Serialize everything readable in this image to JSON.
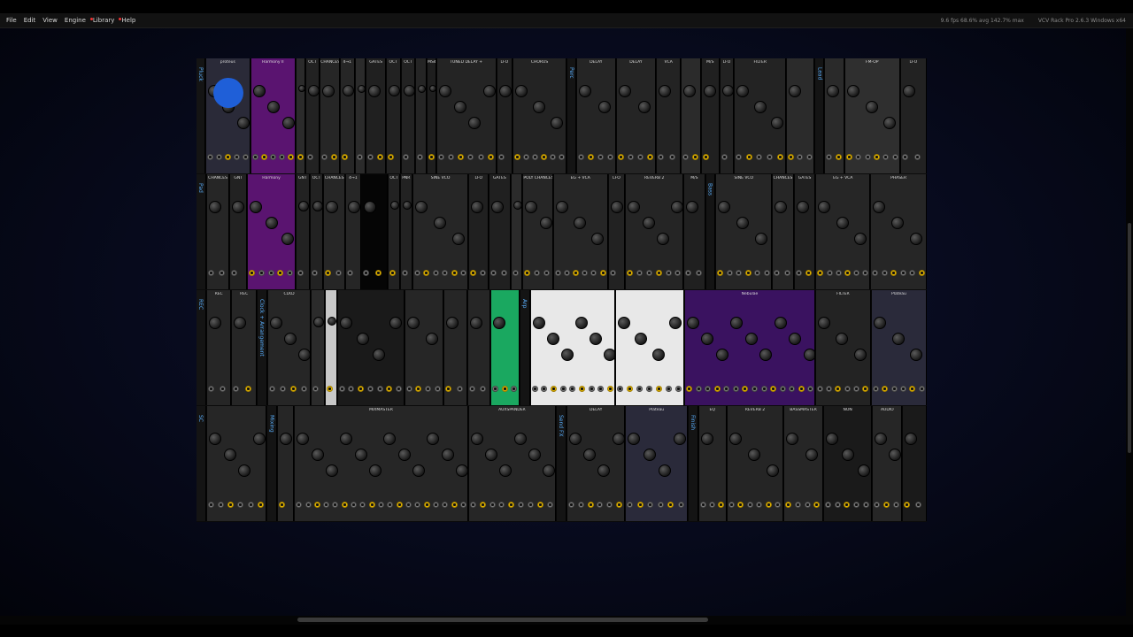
{
  "menubar": {
    "items": [
      {
        "label": "File",
        "dot": false
      },
      {
        "label": "Edit",
        "dot": false
      },
      {
        "label": "View",
        "dot": false
      },
      {
        "label": "Engine",
        "dot": false
      },
      {
        "label": "Library",
        "dot": true
      },
      {
        "label": "Help",
        "dot": true
      }
    ],
    "status": {
      "perf": "9.6 fps  68.6% avg  142.7% max",
      "app": "VCV Rack Pro 2.6.3 Windows x64"
    }
  },
  "colors": {
    "accent_blue": "#5ab0ff",
    "accent_yellow": "#f2c200",
    "accent_purple": "#7a1f8a",
    "accent_green": "#22d030"
  },
  "rows": [
    {
      "modules": [
        {
          "label": "Pluck",
          "bg": "#1c1c1c",
          "w": 10,
          "side": true
        },
        {
          "label": "proteus",
          "bg": "#2a2a38",
          "w": 52,
          "accent": "#1f5fd8"
        },
        {
          "label": "Harmony II",
          "bg": "#5a1470",
          "w": 52
        },
        {
          "label": "",
          "bg": "#2b2b2b",
          "w": 10
        },
        {
          "label": "OCT",
          "bg": "#222",
          "w": 16
        },
        {
          "label": "CHANCES",
          "bg": "#262626",
          "w": 22
        },
        {
          "label": "4→1",
          "bg": "#262626",
          "w": 16
        },
        {
          "label": "",
          "bg": "#2b2b2b",
          "w": 12
        },
        {
          "label": "GATES",
          "bg": "#202020",
          "w": 22
        },
        {
          "label": "OCT",
          "bg": "#222",
          "w": 16
        },
        {
          "label": "OCT",
          "bg": "#222",
          "w": 16
        },
        {
          "label": "",
          "bg": "#252525",
          "w": 12
        },
        {
          "label": "MS4",
          "bg": "#1e1e1e",
          "w": 10
        },
        {
          "label": "TUNED DELAY +",
          "bg": "#242424",
          "w": 70
        },
        {
          "label": "LFO",
          "bg": "#202020",
          "w": 18
        },
        {
          "label": "CHORUS",
          "bg": "#232323",
          "w": 62
        },
        {
          "label": "Perc",
          "bg": "#1c1c1c",
          "w": 10,
          "side": true
        },
        {
          "label": "DELAY",
          "bg": "#252525",
          "w": 46
        },
        {
          "label": "DELAY",
          "bg": "#252525",
          "w": 46
        },
        {
          "label": "VCA",
          "bg": "#232323",
          "w": 28
        },
        {
          "label": "",
          "bg": "#2b2b2b",
          "w": 22
        },
        {
          "label": "M/S",
          "bg": "#202020",
          "w": 20
        },
        {
          "label": "LFO",
          "bg": "#222",
          "w": 16
        },
        {
          "label": "FILTER",
          "bg": "#232323",
          "w": 60
        },
        {
          "label": "",
          "bg": "#2b2b2b",
          "w": 32
        },
        {
          "label": "Lead",
          "bg": "#1c1c1c",
          "w": 10,
          "side": true
        },
        {
          "label": "",
          "bg": "#2a2a2a",
          "w": 22
        },
        {
          "label": "FM-OP",
          "bg": "#2f2f2f",
          "w": 64
        },
        {
          "label": "LFO",
          "bg": "#222",
          "w": 30
        }
      ]
    },
    {
      "modules": [
        {
          "label": "Pad",
          "bg": "#1c1c1c",
          "w": 10,
          "side": true
        },
        {
          "label": "CHANCES",
          "bg": "#262626",
          "w": 24
        },
        {
          "label": "GNT",
          "bg": "#222",
          "w": 18
        },
        {
          "label": "Harmony",
          "bg": "#5a1470",
          "w": 52
        },
        {
          "label": "GNT",
          "bg": "#222",
          "w": 14
        },
        {
          "label": "OCT",
          "bg": "#222",
          "w": 14
        },
        {
          "label": "CHANCES",
          "bg": "#262626",
          "w": 22
        },
        {
          "label": "4→1",
          "bg": "#262626",
          "w": 16
        },
        {
          "label": "",
          "bg": "#050505",
          "w": 28
        },
        {
          "label": "OCT",
          "bg": "#222",
          "w": 12
        },
        {
          "label": "PNR",
          "bg": "#222",
          "w": 12
        },
        {
          "label": "SINE VCO",
          "bg": "#262626",
          "w": 60
        },
        {
          "label": "LFO",
          "bg": "#202020",
          "w": 20
        },
        {
          "label": "GATES",
          "bg": "#202020",
          "w": 22
        },
        {
          "label": "",
          "bg": "#2b2b2b",
          "w": 12
        },
        {
          "label": "POLY CHANCES",
          "bg": "#262626",
          "w": 32
        },
        {
          "label": "EG + VCA",
          "bg": "#262626",
          "w": 58
        },
        {
          "label": "LFO",
          "bg": "#222",
          "w": 18
        },
        {
          "label": "REVERB 2",
          "bg": "#252525",
          "w": 62
        },
        {
          "label": "M/S",
          "bg": "#202020",
          "w": 22
        },
        {
          "label": "Bass",
          "bg": "#1c1c1c",
          "w": 10,
          "side": true
        },
        {
          "label": "SINE VCO",
          "bg": "#262626",
          "w": 60
        },
        {
          "label": "CHANCES",
          "bg": "#262626",
          "w": 22
        },
        {
          "label": "GATES",
          "bg": "#202020",
          "w": 22
        },
        {
          "label": "EG + VCA",
          "bg": "#262626",
          "w": 58
        },
        {
          "label": "PHASER",
          "bg": "#262626",
          "w": 60
        }
      ]
    },
    {
      "modules": [
        {
          "label": "REC",
          "bg": "#1c1c1c",
          "w": 10,
          "side": true
        },
        {
          "label": "REC",
          "bg": "#262626",
          "w": 26
        },
        {
          "label": "REC",
          "bg": "#262626",
          "w": 26
        },
        {
          "label": "Clock + Arrangement",
          "bg": "#1c1c1c",
          "w": 10,
          "side": true
        },
        {
          "label": "CLKD",
          "bg": "#262626",
          "w": 46
        },
        {
          "label": "",
          "bg": "#2b2b2b",
          "w": 14
        },
        {
          "label": "",
          "bg": "#c8c8c8",
          "w": 12
        },
        {
          "label": "",
          "bg": "#1a1a1a",
          "w": 72
        },
        {
          "label": "",
          "bg": "#262626",
          "w": 42
        },
        {
          "label": "",
          "bg": "#262626",
          "w": 24
        },
        {
          "label": "",
          "bg": "#262626",
          "w": 24
        },
        {
          "label": "",
          "bg": "#1aa860",
          "w": 30
        },
        {
          "label": "Arp",
          "bg": "#1c1c1c",
          "w": 10,
          "side": true
        },
        {
          "label": "",
          "bg": "#e8e8e8",
          "w": 92
        },
        {
          "label": "",
          "bg": "#e8e8e8",
          "w": 74
        },
        {
          "label": "Nebulae",
          "bg": "#3a1260",
          "w": 142
        },
        {
          "label": "FILTER",
          "bg": "#232323",
          "w": 60
        },
        {
          "label": "Plateau",
          "bg": "#2a2a3a",
          "w": 60
        }
      ]
    },
    {
      "modules": [
        {
          "label": "SC",
          "bg": "#1c1c1c",
          "w": 10,
          "side": true
        },
        {
          "label": "",
          "bg": "#262626",
          "w": 62
        },
        {
          "label": "Mixing",
          "bg": "#1c1c1c",
          "w": 10,
          "side": true
        },
        {
          "label": "",
          "bg": "#262626",
          "w": 16
        },
        {
          "label": "MIXMASTER",
          "bg": "#262626",
          "w": 180
        },
        {
          "label": "AUXSPANDER",
          "bg": "#262626",
          "w": 90
        },
        {
          "label": "Send FX",
          "bg": "#1c1c1c",
          "w": 10,
          "side": true
        },
        {
          "label": "DELAY",
          "bg": "#252525",
          "w": 60
        },
        {
          "label": "Plateau",
          "bg": "#2a2a3a",
          "w": 64
        },
        {
          "label": "Finish",
          "bg": "#1c1c1c",
          "w": 10,
          "side": true
        },
        {
          "label": "EQ",
          "bg": "#262626",
          "w": 28
        },
        {
          "label": "REVERB 2",
          "bg": "#252525",
          "w": 58
        },
        {
          "label": "BASSMASTER",
          "bg": "#262626",
          "w": 40
        },
        {
          "label": "NON",
          "bg": "#1a1a1a",
          "w": 50
        },
        {
          "label": "AUDIO",
          "bg": "#262626",
          "w": 30
        },
        {
          "label": "",
          "bg": "#1a1a1a",
          "w": 24
        }
      ]
    }
  ]
}
